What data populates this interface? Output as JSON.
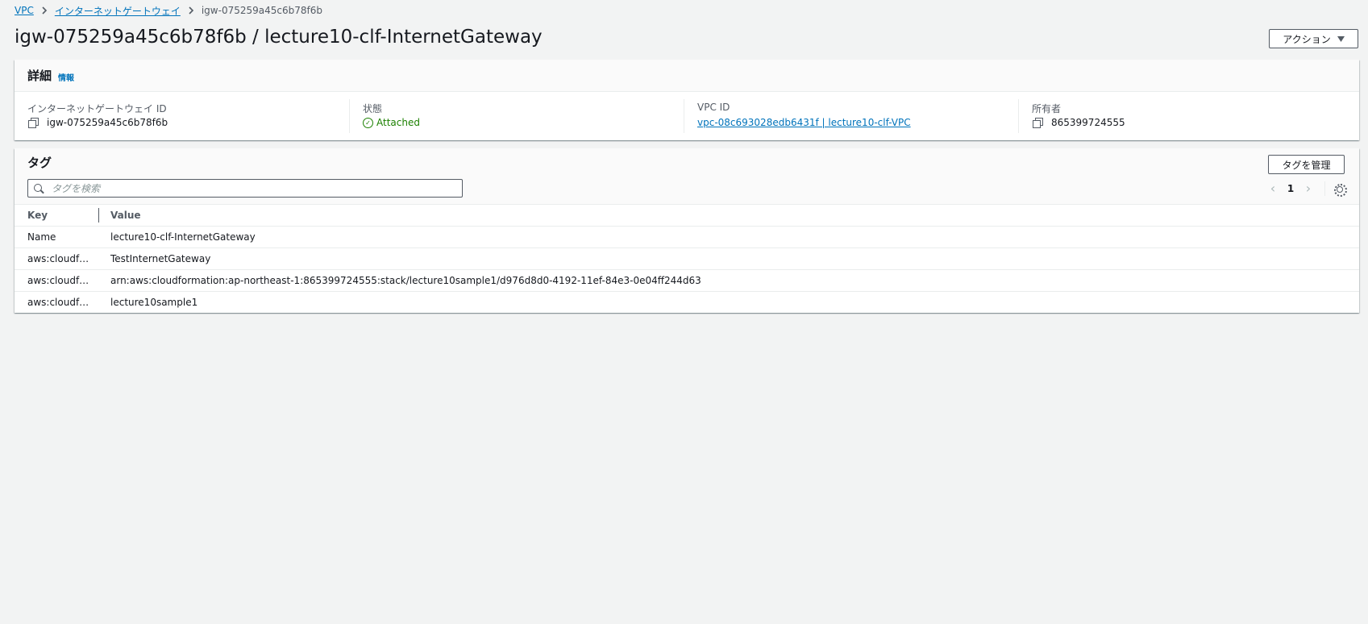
{
  "breadcrumb": {
    "items": [
      "VPC",
      "インターネットゲートウェイ"
    ],
    "current": "igw-075259a45c6b78f6b"
  },
  "page": {
    "title": "igw-075259a45c6b78f6b / lecture10-clf-InternetGateway",
    "actions_label": "アクション"
  },
  "details": {
    "title": "詳細",
    "info_label": "情報",
    "fields": {
      "igw_id_label": "インターネットゲートウェイ ID",
      "igw_id_value": "igw-075259a45c6b78f6b",
      "state_label": "状態",
      "state_value": "Attached",
      "vpc_id_label": "VPC ID",
      "vpc_id_value": "vpc-08c693028edb6431f | lecture10-clf-VPC",
      "owner_label": "所有者",
      "owner_value": "865399724555"
    }
  },
  "tags": {
    "title": "タグ",
    "manage_label": "タグを管理",
    "search_placeholder": "タグを検索",
    "page_number": "1",
    "columns": [
      "Key",
      "Value"
    ],
    "rows": [
      {
        "key": "Name",
        "value": "lecture10-clf-InternetGateway"
      },
      {
        "key": "aws:cloudf…",
        "value": "TestInternetGateway"
      },
      {
        "key": "aws:cloudf…",
        "value": "arn:aws:cloudformation:ap-northeast-1:865399724555:stack/lecture10sample1/d976d8d0-4192-11ef-84e3-0e04ff244d63"
      },
      {
        "key": "aws:cloudf…",
        "value": "lecture10sample1"
      }
    ]
  },
  "colors": {
    "link": "#0073bb",
    "success": "#1d8102",
    "background": "#f2f3f3"
  }
}
